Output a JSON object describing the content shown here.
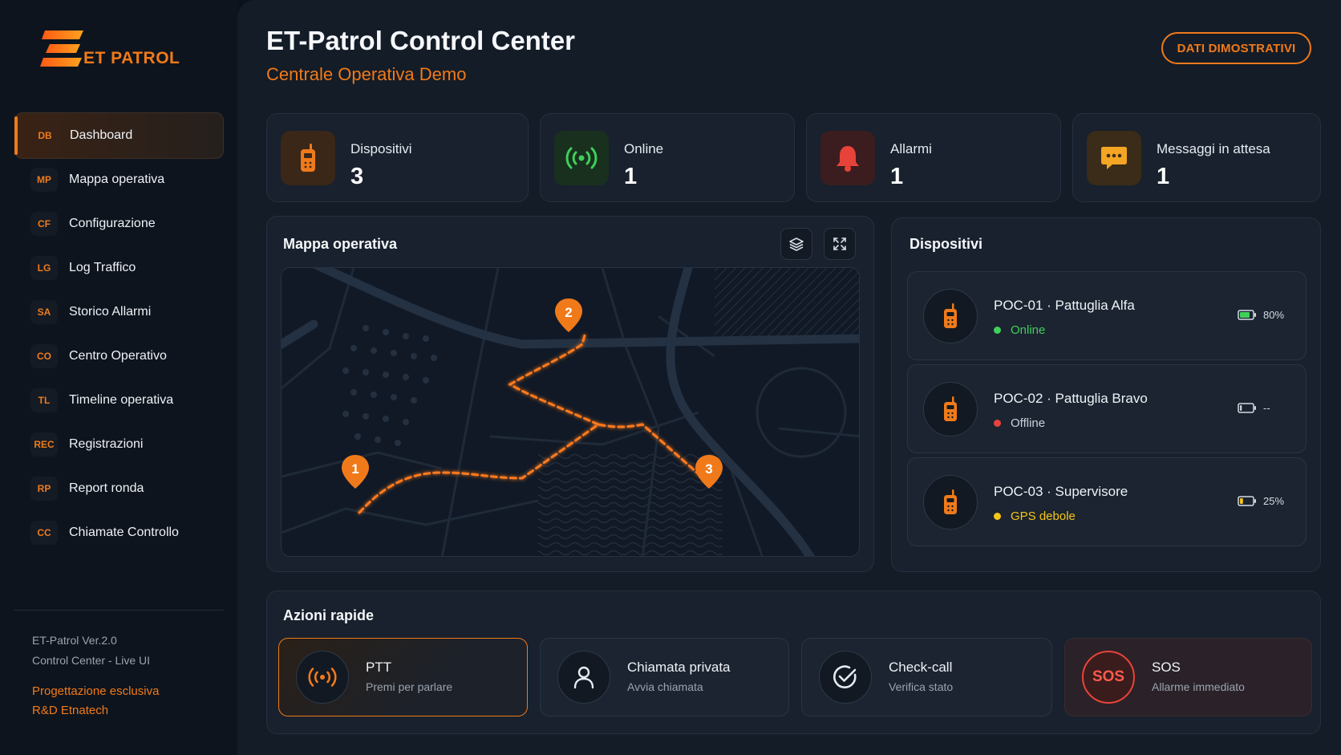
{
  "brand": {
    "logo_text": "ET PATROL",
    "accent": "#f07a1a"
  },
  "sidebar": {
    "items": [
      {
        "code": "DB",
        "label": "Dashboard",
        "active": true
      },
      {
        "code": "MP",
        "label": "Mappa operativa"
      },
      {
        "code": "CF",
        "label": "Configurazione"
      },
      {
        "code": "LG",
        "label": "Log Traffico"
      },
      {
        "code": "SA",
        "label": "Storico Allarmi"
      },
      {
        "code": "CO",
        "label": "Centro Operativo"
      },
      {
        "code": "TL",
        "label": "Timeline operativa"
      },
      {
        "code": "REC",
        "label": "Registrazioni"
      },
      {
        "code": "RP",
        "label": "Report ronda"
      },
      {
        "code": "CC",
        "label": "Chiamate Controllo"
      }
    ],
    "version": "ET-Patrol Ver.2.0",
    "ui_mode": "Control Center - Live UI",
    "credit_line1": "Progettazione esclusiva",
    "credit_line2": "R&D Etnatech"
  },
  "header": {
    "title": "ET-Patrol Control Center",
    "subtitle": "Centrale Operativa Demo",
    "demo_button": "DATI DIMOSTRATIVI"
  },
  "stats": [
    {
      "label": "Dispositivi",
      "value": "3",
      "icon": "walkie-talkie-icon",
      "color": "#f07a1a"
    },
    {
      "label": "Online",
      "value": "1",
      "icon": "broadcast-signal-icon",
      "color": "#3fcf5a"
    },
    {
      "label": "Allarmi",
      "value": "1",
      "icon": "bell-icon",
      "color": "#e8433a"
    },
    {
      "label": "Messaggi in attesa",
      "value": "1",
      "icon": "chat-bubble-icon",
      "color": "#f5a524"
    }
  ],
  "map": {
    "title": "Mappa operativa",
    "tools": [
      "layers-icon",
      "fullscreen-icon"
    ],
    "markers": [
      {
        "label": "1"
      },
      {
        "label": "2"
      },
      {
        "label": "3"
      }
    ]
  },
  "devices": {
    "title": "Dispositivi",
    "items": [
      {
        "id": "POC-01",
        "name": "Pattuglia Alfa",
        "status": "Online",
        "status_color": "#3fcf5a",
        "battery": "80%",
        "battery_level": 0.8,
        "battery_color": "#3fcf5a"
      },
      {
        "id": "POC-02",
        "name": "Pattuglia Bravo",
        "status": "Offline",
        "status_color": "#e8433a",
        "battery": "--",
        "battery_level": 0.15,
        "battery_color": "#c9d1db"
      },
      {
        "id": "POC-03",
        "name": "Supervisore",
        "status": "GPS debole",
        "status_color": "#f5c518",
        "battery": "25%",
        "battery_level": 0.25,
        "battery_color": "#f5c518"
      }
    ]
  },
  "actions": {
    "title": "Azioni rapide",
    "items": [
      {
        "title": "PTT",
        "subtitle": "Premi per parlare",
        "icon": "broadcast-signal-icon"
      },
      {
        "title": "Chiamata privata",
        "subtitle": "Avvia chiamata",
        "icon": "user-icon"
      },
      {
        "title": "Check-call",
        "subtitle": "Verifica stato",
        "icon": "check-circle-icon"
      },
      {
        "title": "SOS",
        "subtitle": "Allarme immediato",
        "icon_text": "SOS"
      }
    ]
  }
}
